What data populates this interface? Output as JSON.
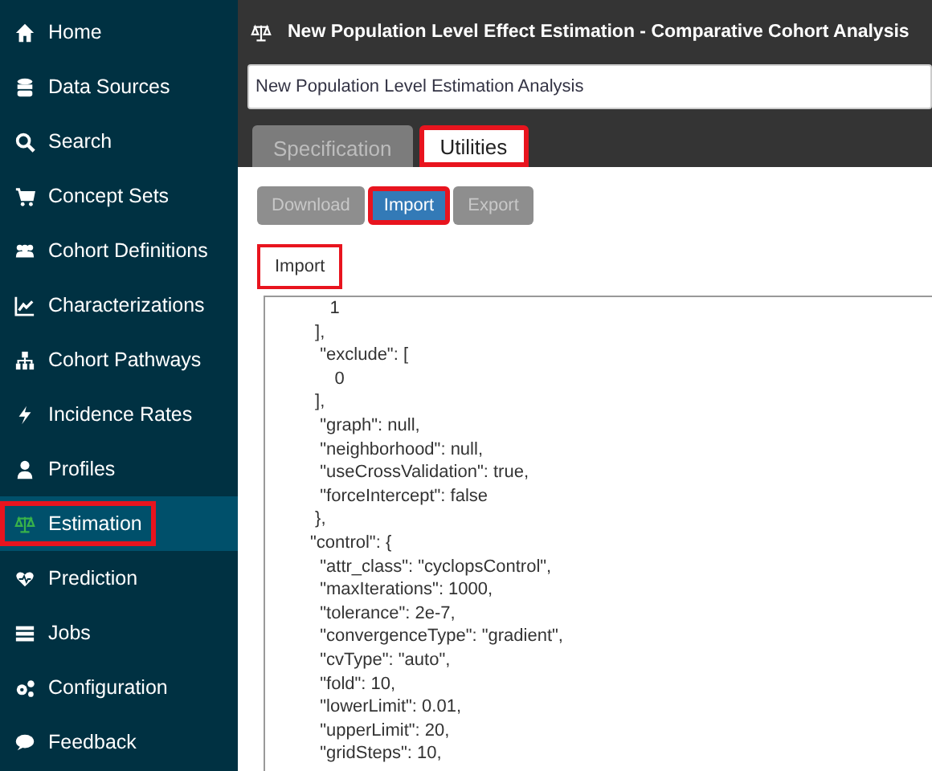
{
  "sidebar": {
    "items": [
      {
        "label": "Home",
        "selected": false,
        "highlighted": false
      },
      {
        "label": "Data Sources",
        "selected": false,
        "highlighted": false
      },
      {
        "label": "Search",
        "selected": false,
        "highlighted": false
      },
      {
        "label": "Concept Sets",
        "selected": false,
        "highlighted": false
      },
      {
        "label": "Cohort Definitions",
        "selected": false,
        "highlighted": false
      },
      {
        "label": "Characterizations",
        "selected": false,
        "highlighted": false
      },
      {
        "label": "Cohort Pathways",
        "selected": false,
        "highlighted": false
      },
      {
        "label": "Incidence Rates",
        "selected": false,
        "highlighted": false
      },
      {
        "label": "Profiles",
        "selected": false,
        "highlighted": false
      },
      {
        "label": "Estimation",
        "selected": true,
        "highlighted": true
      },
      {
        "label": "Prediction",
        "selected": false,
        "highlighted": false
      },
      {
        "label": "Jobs",
        "selected": false,
        "highlighted": false
      },
      {
        "label": "Configuration",
        "selected": false,
        "highlighted": false
      },
      {
        "label": "Feedback",
        "selected": false,
        "highlighted": false
      }
    ]
  },
  "header": {
    "title": "New Population Level Effect Estimation - Comparative Cohort Analysis"
  },
  "name_field": {
    "value": "New Population Level Estimation Analysis"
  },
  "tabs": [
    {
      "label": "Specification",
      "selected": false,
      "highlighted": false
    },
    {
      "label": "Utilities",
      "selected": true,
      "highlighted": true
    }
  ],
  "buttons": [
    {
      "label": "Download",
      "selected": false,
      "highlighted": false
    },
    {
      "label": "Import",
      "selected": true,
      "highlighted": true
    },
    {
      "label": "Export",
      "selected": false,
      "highlighted": false
    }
  ],
  "section": {
    "label": "Import",
    "highlighted": true
  },
  "code_lines": [
    "    1",
    " ],",
    "  \"exclude\": [",
    "     0",
    " ],",
    "  \"graph\": null,",
    "  \"neighborhood\": null,",
    "  \"useCrossValidation\": true,",
    "  \"forceIntercept\": false",
    " },",
    "\"control\": {",
    "  \"attr_class\": \"cyclopsControl\",",
    "  \"maxIterations\": 1000,",
    "  \"tolerance\": 2e-7,",
    "  \"convergenceType\": \"gradient\",",
    "  \"cvType\": \"auto\",",
    "  \"fold\": 10,",
    "  \"lowerLimit\": 0.01,",
    "  \"upperLimit\": 20,",
    "  \"gridSteps\": 10,"
  ]
}
